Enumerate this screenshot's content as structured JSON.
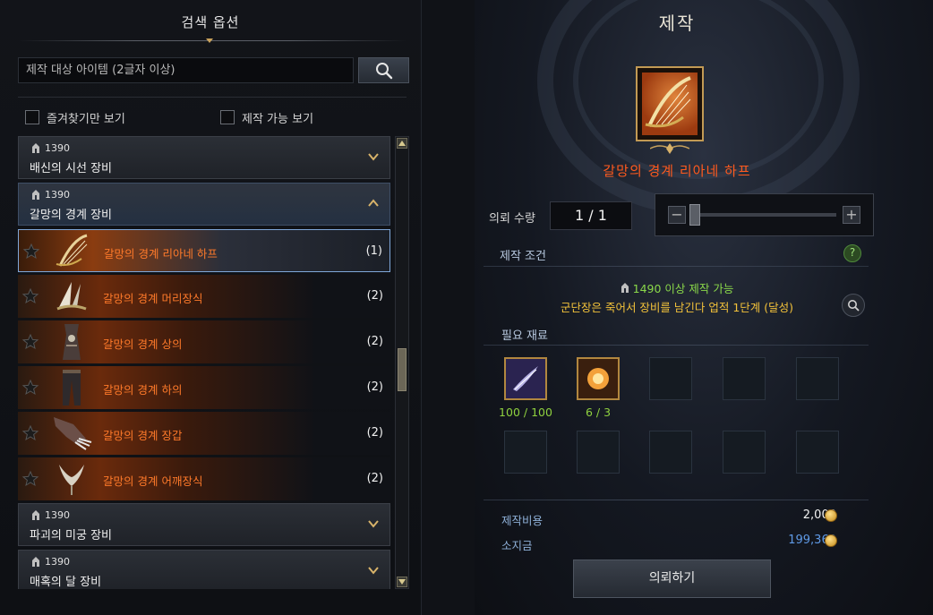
{
  "left_panel": {
    "title": "검색 옵션",
    "search": {
      "placeholder": "제작 대상 아이템 (2글자 이상)",
      "value": ""
    },
    "filters": [
      {
        "label": "즐겨찾기만 보기",
        "checked": false
      },
      {
        "label": "제작 가능 보기",
        "checked": false
      }
    ],
    "categories": [
      {
        "level": "1390",
        "name": "배신의 시선 장비",
        "expanded": false
      },
      {
        "level": "1390",
        "name": "갈망의 경계 장비",
        "expanded": true,
        "items": [
          {
            "name": "갈망의 경계 리아네 하프",
            "count": "(1)",
            "selected": true,
            "icon": "harp-icon"
          },
          {
            "name": "갈망의 경계 머리장식",
            "count": "(2)",
            "selected": false,
            "icon": "headpiece-icon"
          },
          {
            "name": "갈망의 경계 상의",
            "count": "(2)",
            "selected": false,
            "icon": "top-armor-icon"
          },
          {
            "name": "갈망의 경계 하의",
            "count": "(2)",
            "selected": false,
            "icon": "pants-icon"
          },
          {
            "name": "갈망의 경계 장갑",
            "count": "(2)",
            "selected": false,
            "icon": "glove-icon"
          },
          {
            "name": "갈망의 경계 어깨장식",
            "count": "(2)",
            "selected": false,
            "icon": "shoulder-icon"
          }
        ]
      },
      {
        "level": "1390",
        "name": "파괴의 미궁 장비",
        "expanded": false
      },
      {
        "level": "1390",
        "name": "매혹의 달 장비",
        "expanded": false
      }
    ]
  },
  "right_panel": {
    "title": "제작",
    "item_name": "갈망의 경계 리아네 하프",
    "quantity_label": "의뢰 수량",
    "quantity_value": "1 / 1",
    "slider_minus": "−",
    "slider_plus": "+",
    "conditions_header": "제작 조건",
    "help_symbol": "?",
    "condition_level": "1490 이상 제작 가능",
    "condition_quest": "군단장은 죽어서 장비를 남긴다 업적 1단계 (달성)",
    "materials_header": "필요 재료",
    "materials": [
      {
        "icon": "feather-material-icon",
        "count": "100 / 100",
        "filled": true
      },
      {
        "icon": "orb-material-icon",
        "count": "6 / 3",
        "filled": true
      }
    ],
    "cost_label": "제작비용",
    "cost_value": "2,000",
    "gold_label": "소지금",
    "gold_value": "199,369",
    "request_button": "의뢰하기"
  },
  "colors": {
    "item_name_orange": "#ff7a2a",
    "title_orange": "#ff5a1e",
    "condition_green": "#8ad84a",
    "condition_yellow": "#f3c23a",
    "gold_blue": "#5f9ae6"
  }
}
